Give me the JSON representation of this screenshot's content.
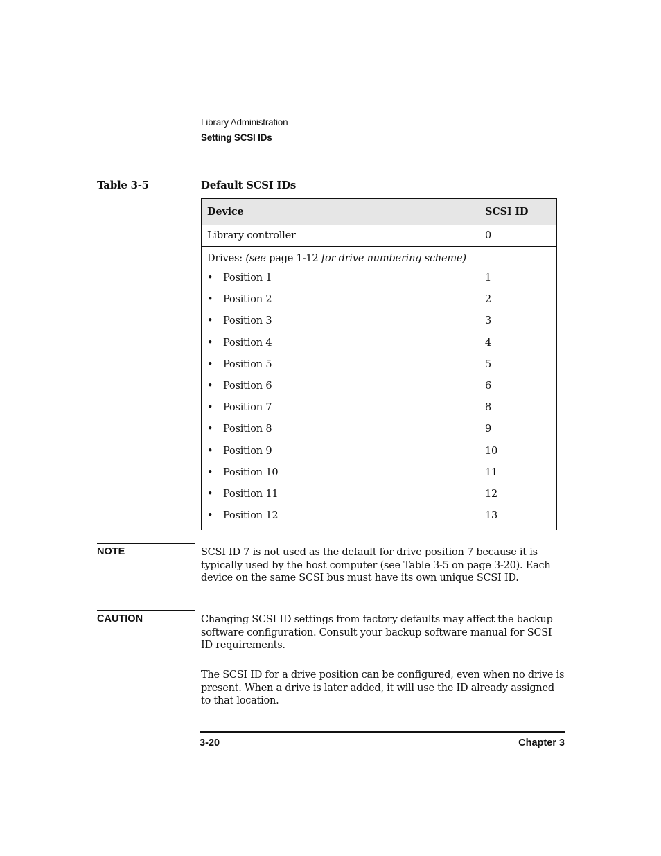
{
  "running_head": {
    "chapter_title": "Library Administration",
    "section_title": "Setting SCSI IDs"
  },
  "table": {
    "number": "Table 3-5",
    "title": "Default SCSI IDs",
    "columns": [
      "Device",
      "SCSI ID"
    ],
    "controller_row": {
      "device": "Library controller",
      "scsi_id": "0"
    },
    "drives_intro": {
      "label": "Drives: ",
      "see": "(see",
      "page_ref": " page 1-12 ",
      "scheme": "for drive numbering scheme)"
    },
    "bullet": "•",
    "drives": [
      {
        "position": "Position 1",
        "scsi_id": "1"
      },
      {
        "position": "Position 2",
        "scsi_id": "2"
      },
      {
        "position": "Position 3",
        "scsi_id": "3"
      },
      {
        "position": "Position 4",
        "scsi_id": "4"
      },
      {
        "position": "Position 5",
        "scsi_id": "5"
      },
      {
        "position": "Position 6",
        "scsi_id": "6"
      },
      {
        "position": "Position 7",
        "scsi_id": "8"
      },
      {
        "position": "Position 8",
        "scsi_id": "9"
      },
      {
        "position": "Position 9",
        "scsi_id": "10"
      },
      {
        "position": "Position 10",
        "scsi_id": "11"
      },
      {
        "position": "Position 11",
        "scsi_id": "12"
      },
      {
        "position": "Position 12",
        "scsi_id": "13"
      }
    ]
  },
  "note": {
    "label": "NOTE",
    "text": "SCSI ID 7 is not used as the default for drive position 7 because it is typically used by the host computer (see Table 3-5 on page 3-20). Each device on the same SCSI bus must have its own unique SCSI ID."
  },
  "caution": {
    "label": "CAUTION",
    "text": "Changing SCSI ID settings from factory defaults may affect the backup software configuration. Consult your backup software manual for SCSI ID requirements."
  },
  "body_paragraph": "The SCSI ID for a drive position can be configured, even when no drive is present. When a drive is later added, it will use the ID already assigned to that location.",
  "footer": {
    "page_number": "3-20",
    "chapter": "Chapter 3"
  }
}
